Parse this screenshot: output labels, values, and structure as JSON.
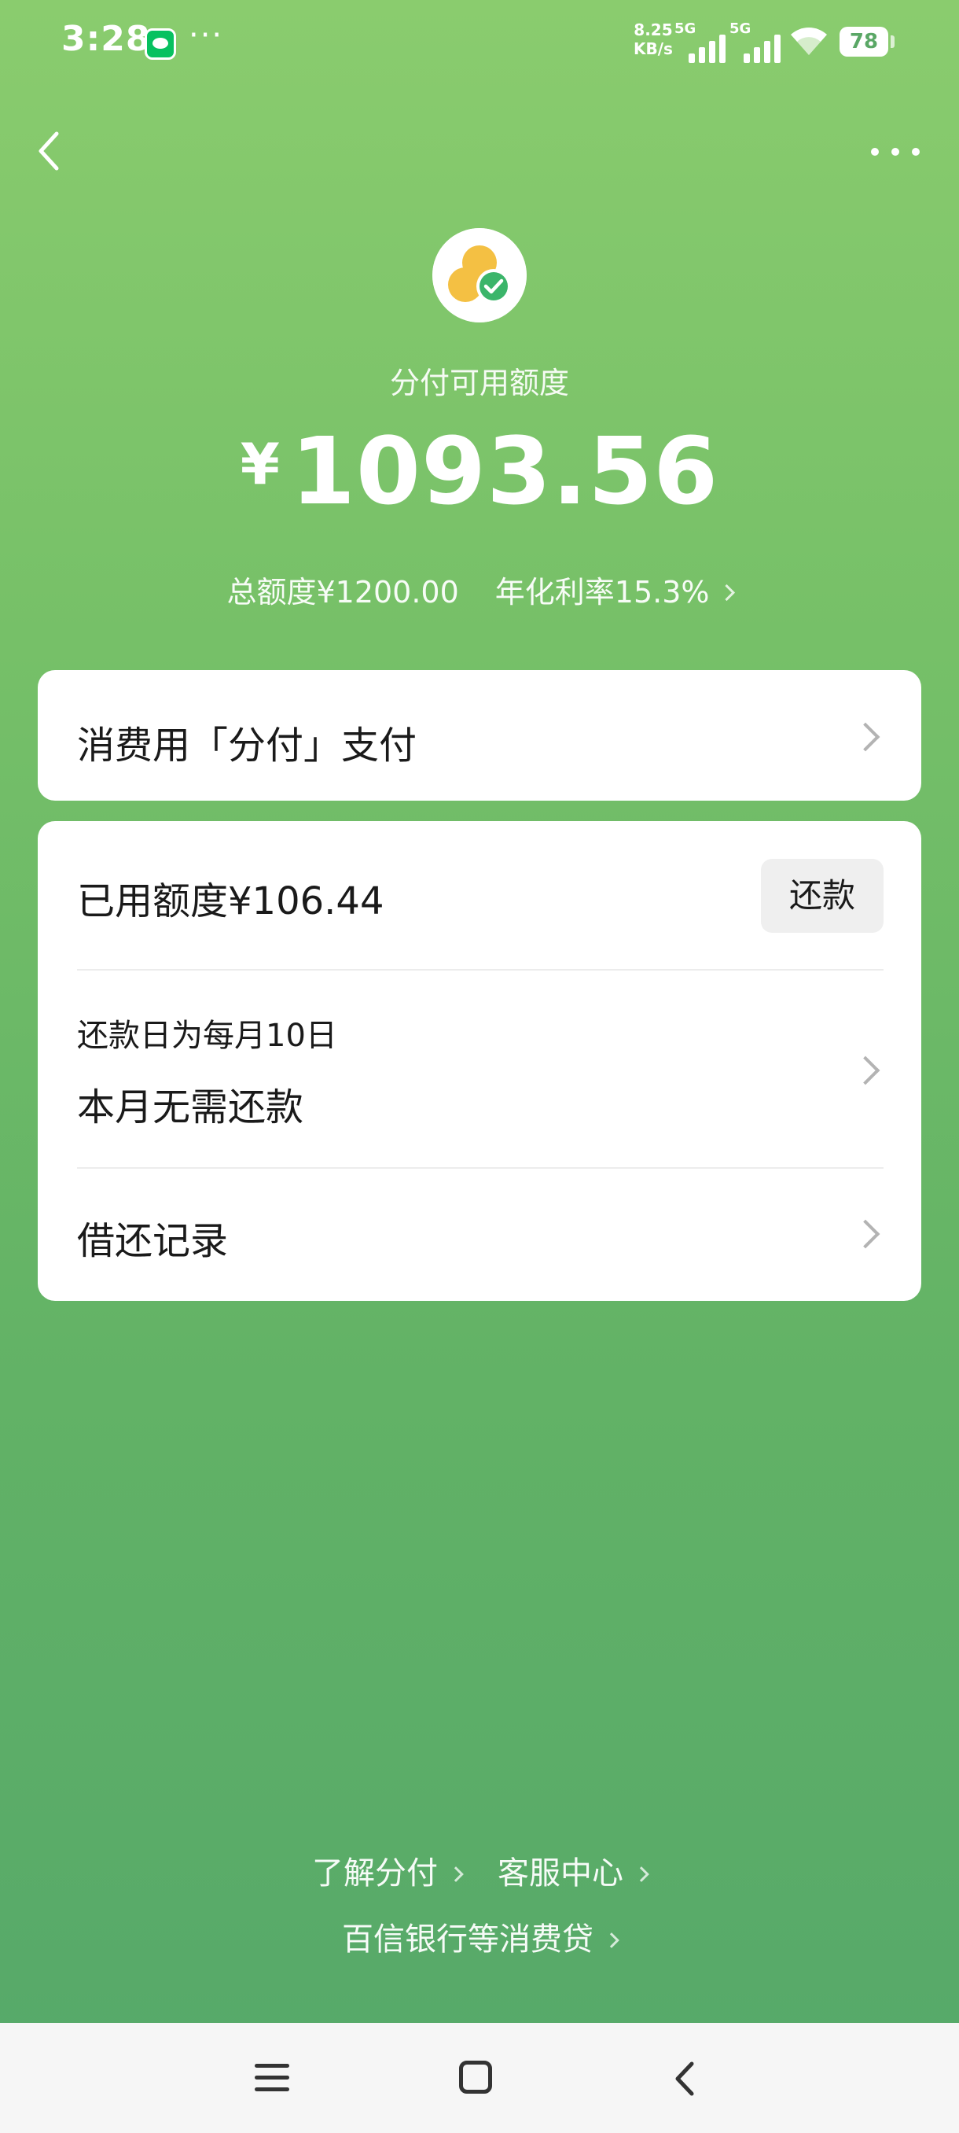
{
  "status_bar": {
    "time": "3:28",
    "more": "···",
    "net_speed_value": "8.25",
    "net_speed_unit": "KB/s",
    "sim1_label": "5G",
    "sim2_label": "5G",
    "battery": "78"
  },
  "header": {
    "available_label": "分付可用额度",
    "currency_symbol": "¥",
    "available_amount": "1093.56",
    "total_limit": "总额度¥1200.00",
    "annual_rate": "年化利率15.3%"
  },
  "pay_card": {
    "label": "消费用「分付」支付"
  },
  "credit_card": {
    "used_label": "已用额度¥106.44",
    "repay_button": "还款",
    "due_rule": "还款日为每月10日",
    "due_status": "本月无需还款",
    "records_label": "借还记录"
  },
  "footer": {
    "learn_link": "了解分付",
    "service_link": "客服中心",
    "lender_link": "百信银行等消费贷"
  }
}
